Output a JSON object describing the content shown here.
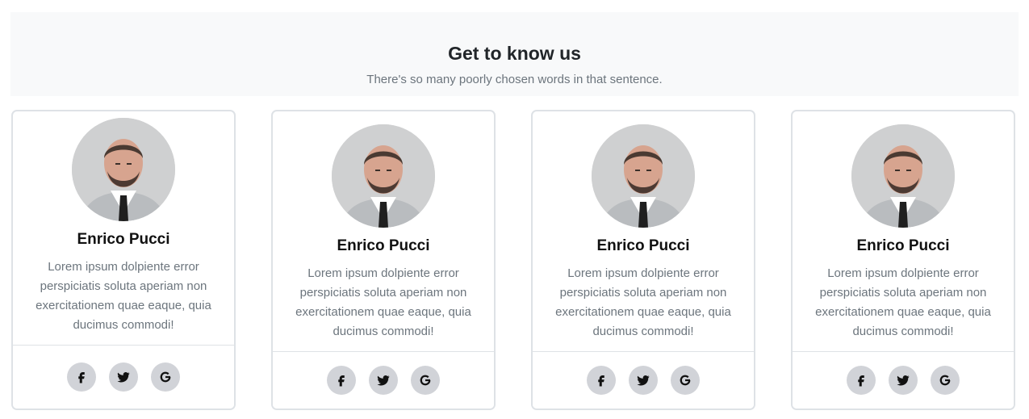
{
  "hero": {
    "title": "Get to know us",
    "subtitle": "There's so many poorly chosen words in that sentence."
  },
  "cards": [
    {
      "name": "Enrico Pucci",
      "description": "Lorem ipsum dolpiente error perspiciatis soluta aperiam non exercitationem quae eaque, quia ducimus commodi!",
      "social": [
        "facebook-icon",
        "twitter-icon",
        "google-icon"
      ]
    },
    {
      "name": "Enrico Pucci",
      "description": "Lorem ipsum dolpiente error perspiciatis soluta aperiam non exercitationem quae eaque, quia ducimus commodi!",
      "social": [
        "facebook-icon",
        "twitter-icon",
        "google-icon"
      ]
    },
    {
      "name": "Enrico Pucci",
      "description": "Lorem ipsum dolpiente error perspiciatis soluta aperiam non exercitationem quae eaque, quia ducimus commodi!",
      "social": [
        "facebook-icon",
        "twitter-icon",
        "google-icon"
      ]
    },
    {
      "name": "Enrico Pucci",
      "description": "Lorem ipsum dolpiente error perspiciatis soluta aperiam non exercitationem quae eaque, quia ducimus commodi!",
      "social": [
        "facebook-icon",
        "twitter-icon",
        "google-icon"
      ]
    }
  ],
  "colors": {
    "hero_bg": "#f8f9fa",
    "muted_text": "#6c757d",
    "border": "#dee2e6",
    "social_bg": "#d1d3d8"
  }
}
